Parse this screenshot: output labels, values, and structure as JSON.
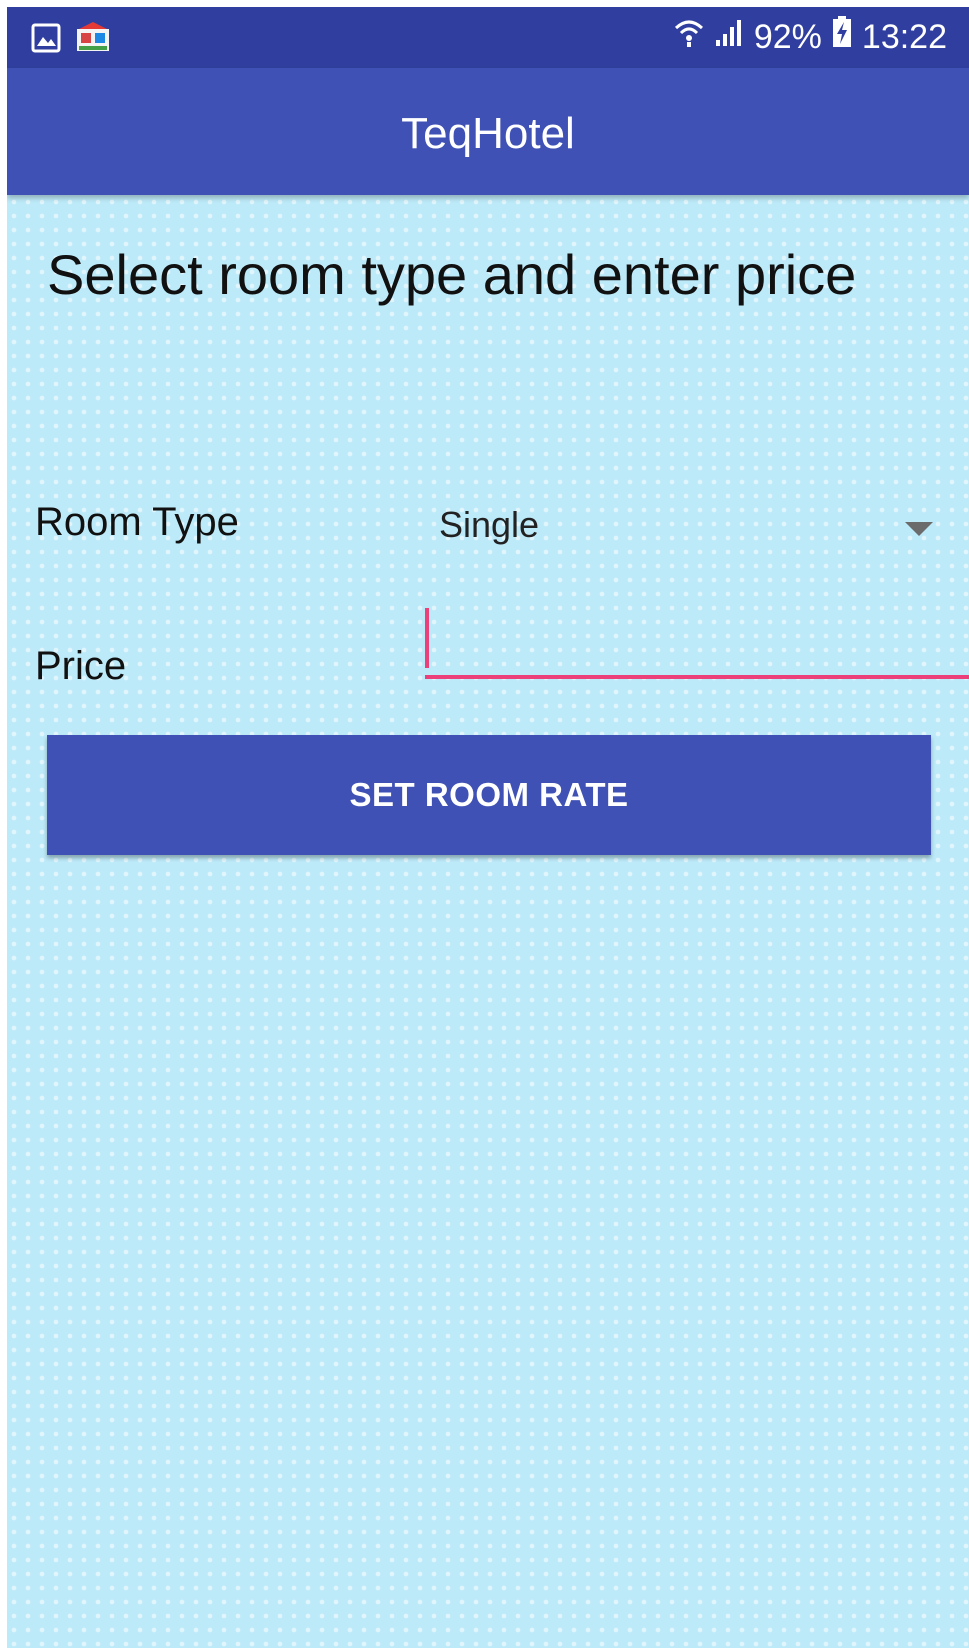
{
  "status_bar": {
    "battery_percent": "92%",
    "time": "13:22",
    "icons": [
      "gallery-icon",
      "app-notification-icon",
      "wifi-icon",
      "signal-icon",
      "battery-charging-icon"
    ]
  },
  "app_bar": {
    "title": "TeqHotel",
    "background_color": "#3f51b5"
  },
  "form": {
    "heading": "Select room type and enter price",
    "room_type_label": "Room Type",
    "room_type_selected": "Single",
    "price_label": "Price",
    "price_value": "",
    "submit_label": "SET ROOM RATE",
    "accent_color": "#ec407a",
    "background_color": "#bdeaf9"
  }
}
